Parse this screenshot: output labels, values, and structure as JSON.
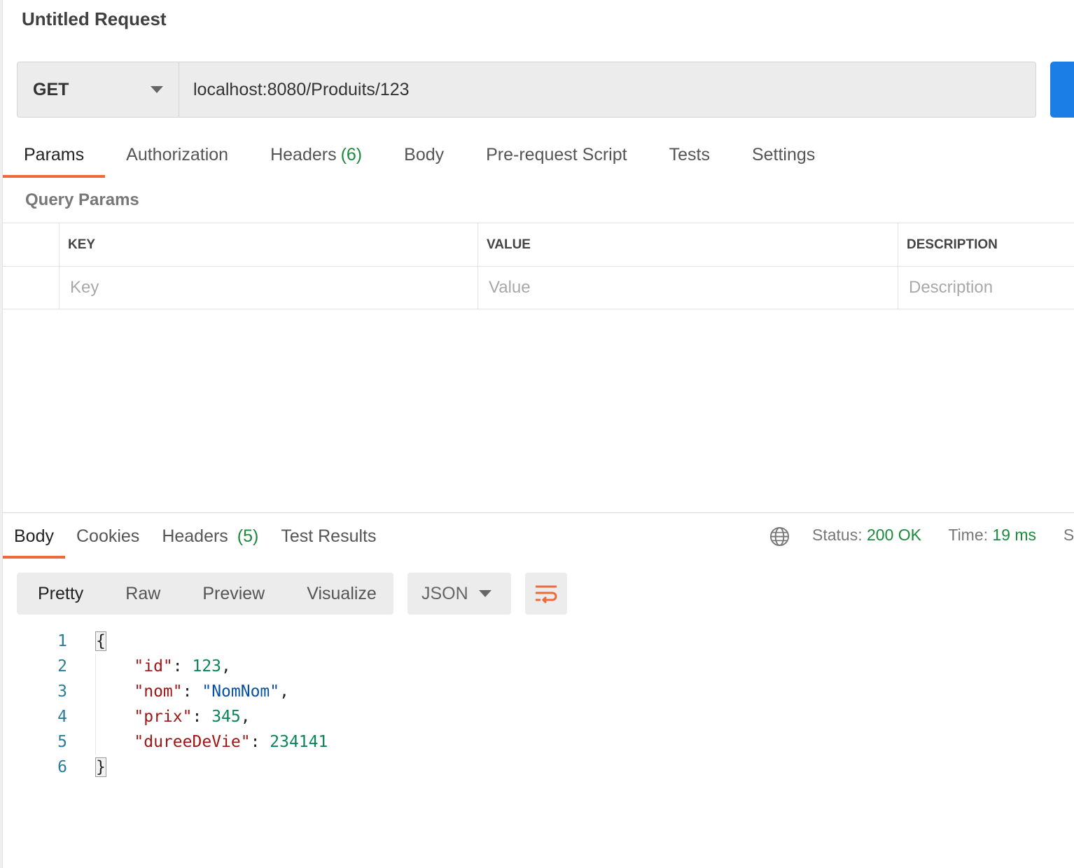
{
  "request": {
    "title": "Untitled Request",
    "method": "GET",
    "url": "localhost:8080/Produits/123"
  },
  "request_tabs": {
    "params": "Params",
    "authorization": "Authorization",
    "headers": "Headers",
    "headers_count": "(6)",
    "body": "Body",
    "prerequest": "Pre-request Script",
    "tests": "Tests",
    "settings": "Settings"
  },
  "query_params": {
    "label": "Query Params",
    "columns": {
      "key": "KEY",
      "value": "VALUE",
      "description": "DESCRIPTION"
    },
    "placeholders": {
      "key": "Key",
      "value": "Value",
      "description": "Description"
    }
  },
  "response_tabs": {
    "body": "Body",
    "cookies": "Cookies",
    "headers": "Headers",
    "headers_count": "(5)",
    "test_results": "Test Results"
  },
  "response_meta": {
    "status_label": "Status:",
    "status_value": "200 OK",
    "time_label": "Time:",
    "time_value": "19 ms",
    "size_label_partial": "Size"
  },
  "response_view": {
    "pretty": "Pretty",
    "raw": "Raw",
    "preview": "Preview",
    "visualize": "Visualize",
    "format": "JSON"
  },
  "response_body": {
    "line_numbers": [
      "1",
      "2",
      "3",
      "4",
      "5",
      "6"
    ],
    "open_brace": "{",
    "close_brace": "}",
    "fields": [
      {
        "key": "\"id\"",
        "value": "123",
        "type": "number",
        "trail": ","
      },
      {
        "key": "\"nom\"",
        "value": "\"NomNom\"",
        "type": "string",
        "trail": ","
      },
      {
        "key": "\"prix\"",
        "value": "345",
        "type": "number",
        "trail": ","
      },
      {
        "key": "\"dureeDeVie\"",
        "value": "234141",
        "type": "number",
        "trail": ""
      }
    ]
  },
  "colors": {
    "accent_tab": "#ef6a3a",
    "send_button": "#1a7ee6",
    "status_ok": "#1b8a3b",
    "json_key": "#a31515",
    "json_number": "#098658",
    "json_string": "#0451a5"
  }
}
